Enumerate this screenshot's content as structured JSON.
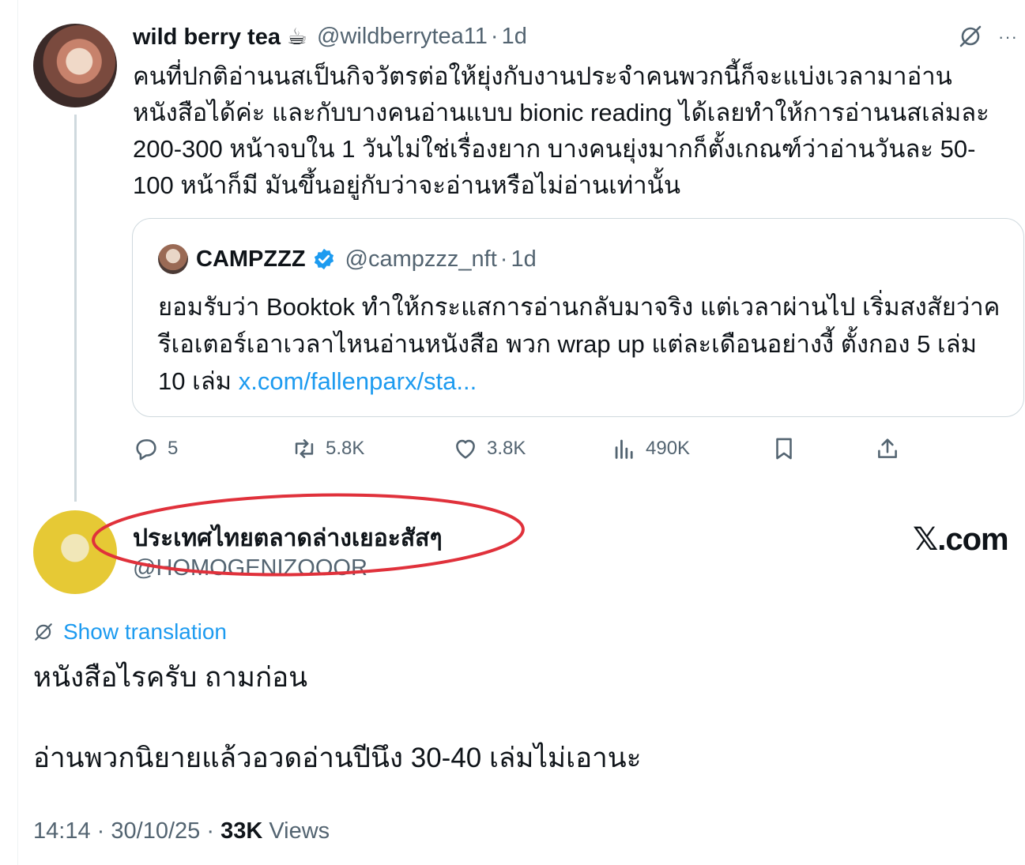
{
  "parent_tweet": {
    "display_name": "wild berry tea ☕",
    "handle": "@wildberrytea11",
    "separator": "·",
    "time": "1d",
    "text": "คนที่ปกติอ่านนสเป็นกิจวัตรต่อให้ยุ่งกับงานประจำคนพวกนี้ก็จะแบ่งเวลามาอ่านหนังสือได้ค่ะ และกับบางคนอ่านแบบ bionic reading ได้เลยทำให้การอ่านนสเล่มละ 200-300 หน้าจบใน 1 วันไม่ใช่เรื่องยาก บางคนยุ่งมากก็ตั้งเกณฑ์ว่าอ่านวันละ 50-100 หน้าก็มี มันขึ้นอยู่กับว่าจะอ่านหรือไม่อ่านเท่านั้น",
    "more_icon": "more-dots-icon",
    "grok_icon": "translate-slash-icon"
  },
  "quote": {
    "display_name": "CAMPZZZ",
    "verified_icon": "verified-badge-icon",
    "handle": "@campzzz_nft",
    "separator": "·",
    "time": "1d",
    "text": "ยอมรับว่า Booktok ทำให้กระแสการอ่านกลับมาจริง แต่เวลาผ่านไป เริ่มสงสัยว่าครีเอเตอร์เอาเวลาไหนอ่านหนังสือ พวก wrap up แต่ละเดือนอย่างงี้ ตั้งกอง 5 เล่ม 10 เล่ม ",
    "link": "x.com/fallenparx/sta..."
  },
  "actions": {
    "reply_count": "5",
    "retweet_count": "5.8K",
    "like_count": "3.8K",
    "view_count": "490K"
  },
  "reply_tweet": {
    "display_name": "ประเทศไทยตลาดล่างเยอะสัสๆ",
    "handle": "@HOMOGENIZOOOR",
    "show_translation": "Show translation",
    "line1": "หนังสือไรครับ ถามก่อน",
    "line2": "อ่านพวกนิยายแล้วอวดอ่านปีนึง 30-40 เล่มไม่เอานะ",
    "time": "14:14",
    "date": "30/10/25",
    "views_count": "33K",
    "views_label": "Views",
    "meta_sep": "·"
  },
  "watermark": "𝕏.com",
  "colors": {
    "accent": "#1d9bf0",
    "secondary_text": "#536471",
    "annotation": "#e0313b"
  }
}
